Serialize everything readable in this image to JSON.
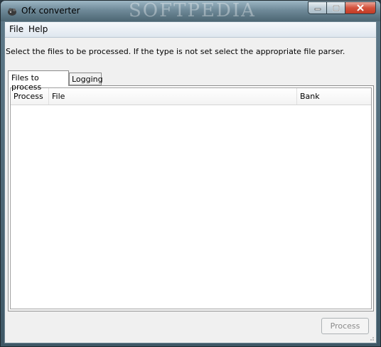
{
  "window": {
    "title": "Ofx converter",
    "icon": "app-icon",
    "watermark": "SOFTPEDIA"
  },
  "menu": {
    "items": [
      {
        "label": "File"
      },
      {
        "label": "Help"
      }
    ]
  },
  "main": {
    "instruction": "Select the files to be processed. If the type is not set select the appropriate file parser.",
    "tabs": [
      {
        "label": "Files to process",
        "active": true
      },
      {
        "label": "Logging",
        "active": false
      }
    ],
    "columns": [
      "Process",
      "File",
      "Bank"
    ],
    "rows": []
  },
  "footer": {
    "process_label": "Process",
    "process_enabled": false
  },
  "colors": {
    "accent": "#c23b24",
    "window_frame": "#5f7a8a",
    "client_bg": "#f0f0f0"
  }
}
